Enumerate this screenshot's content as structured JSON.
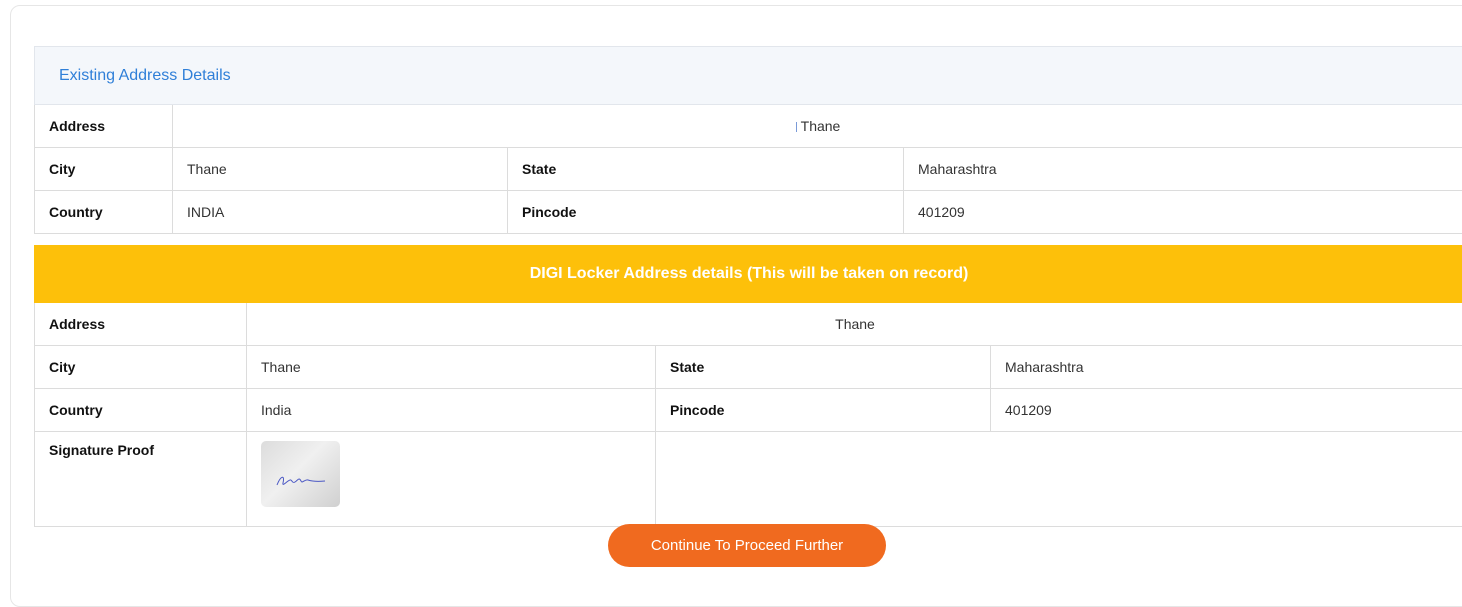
{
  "existing": {
    "title": "Existing Address Details",
    "address_label": "Address",
    "address_value": "Thane",
    "city_label": "City",
    "city_value": "Thane",
    "state_label": "State",
    "state_value": "Maharashtra",
    "country_label": "Country",
    "country_value": "INDIA",
    "pincode_label": "Pincode",
    "pincode_value": "401209"
  },
  "digi": {
    "title": "DIGI Locker Address details (This will be taken on record)",
    "address_label": "Address",
    "address_value": "Thane",
    "city_label": "City",
    "city_value": "Thane",
    "state_label": "State",
    "state_value": "Maharashtra",
    "country_label": "Country",
    "country_value": "India",
    "pincode_label": "Pincode",
    "pincode_value": "401209",
    "signature_label": "Signature Proof"
  },
  "actions": {
    "continue_label": "Continue To Proceed Further"
  },
  "colors": {
    "accent_blue": "#2f7fd8",
    "header_yellow": "#fdc00a",
    "button_orange": "#f06a1f"
  }
}
